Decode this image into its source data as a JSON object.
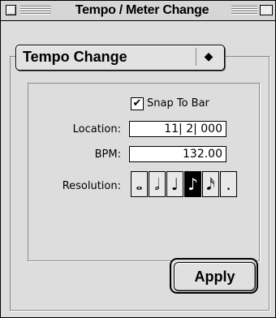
{
  "window": {
    "title": "Tempo / Meter Change"
  },
  "popup": {
    "selected": "Tempo Change",
    "arrows": "◆"
  },
  "snap": {
    "checked_mark": "✔",
    "label": "Snap To Bar",
    "checked": true
  },
  "location": {
    "label": "Location:",
    "value": "11| 2| 000"
  },
  "bpm": {
    "label": "BPM:",
    "value": "132.00"
  },
  "resolution": {
    "label": "Resolution:",
    "options": [
      "𝅝",
      "𝅗𝅥",
      "♩",
      "♪",
      "𝅘𝅥𝅯",
      "."
    ],
    "selected_index": 3
  },
  "apply": {
    "label": "Apply"
  }
}
